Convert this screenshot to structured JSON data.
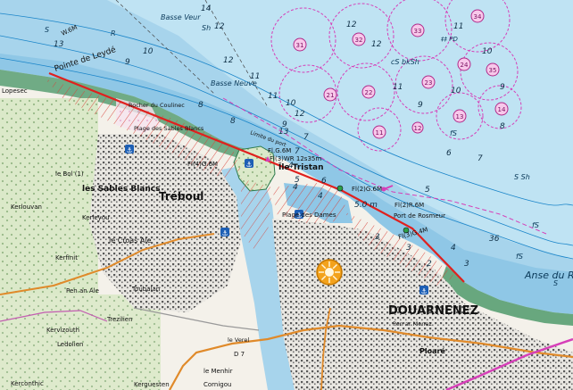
{
  "map": {
    "places": {
      "douarnenez": "DOUARNENEZ",
      "treboul": "Tréboul",
      "sables_blancs": "les Sables Blancs",
      "ile_tristan": "Île Tristan",
      "pointe_leyde": "Pointe de Leydé",
      "port_rosmeur": "Port de Rosmeur",
      "plage_dames": "Plage des Dames",
      "plage_sables": "Plage des Sables Blancs",
      "croas_ale": "le Croas Ale",
      "kerlouvan": "Kerlouvan",
      "kerleyou": "Kerleyou",
      "kerfinit": "Kerfinit",
      "kerbol": "le Bol (1)",
      "pen_an_ale": "Pen an Ale",
      "toubalan": "Toubalan",
      "treziden": "Trezilien",
      "kervizouth": "Kervizouth",
      "ledolien": "Ledolien",
      "kercointic": "Kerconthic",
      "kerguesten": "Kerguesten",
      "cornigou": "Cornigou",
      "le_menhir": "le Menhir",
      "ploare": "Ploaré",
      "anse_ris": "Anse du Ris",
      "lopesec": "Lopesec",
      "rocher_coulinec": "Rocher du Coulinec",
      "pen_ar_menez": "Pen ar Menez",
      "le_verel": "le Verel",
      "limite_port": "Limite du port"
    },
    "sea_marks": {
      "basse_veur": "Basse Veur",
      "basse_neuve": "Basse Neuve",
      "cs_bksh": "cS bkSh",
      "pd": "‡‡ PD",
      "s_sh": "S Sh",
      "fs1": "fS",
      "fs2": "fS",
      "fs3": "fS",
      "r": "R",
      "s": "S",
      "sh": "Sh",
      "s_right": "S",
      "w6m": "W.6M"
    },
    "lights": {
      "ile_tristan": "Fl(3)WR 12s35m",
      "tristan_range": "Fl.G.6M",
      "jetty_green": "Fl(2)G.6M",
      "rosmeur": "Fl(2)R.6M",
      "rosmeur_green": "Fl(3)G.4M",
      "left_light": "Fl(4)G.6M"
    },
    "depths": {
      "d1": "14",
      "d2": "13",
      "d3": "12",
      "d4": "12",
      "d5": "11",
      "d6": "10",
      "d7": "9",
      "d8": "8",
      "d9": "7",
      "d10": "6",
      "d11": "5",
      "d12": "4",
      "d13": "3",
      "d14": "2",
      "d15": "12",
      "d16": "11",
      "d17": "10",
      "d18": "9",
      "d19": "12",
      "d20": "11",
      "d21": "10",
      "d22": "9",
      "d23": "8",
      "d24": "7",
      "d25": "6",
      "d26": "5",
      "d27": "4",
      "d28": "3",
      "d29": "13",
      "d30": "12",
      "d31": "11",
      "d32": "10",
      "d33": "9",
      "d34": "8",
      "d35": "7",
      "d36": "36",
      "d37": "4",
      "d38": "4",
      "d39": "3",
      "d40": "5.0 m"
    },
    "moorings": [
      "31",
      "32",
      "33",
      "34",
      "35",
      "21",
      "22",
      "23",
      "24",
      "25",
      "11",
      "12",
      "13",
      "14"
    ],
    "roads": {
      "d7": "D 7"
    },
    "colors": {
      "sea_deep": "#bfe3f3",
      "sea_shallow": "#9fd0ea",
      "land": "#f4f1ea",
      "forest": "#cfe6c7",
      "route_red": "#e0201e",
      "hatch_red": "#d8423a",
      "magenta": "#d63fb8",
      "road_orange": "#e08a2a",
      "harbor_marker": "#f3a21c"
    }
  }
}
